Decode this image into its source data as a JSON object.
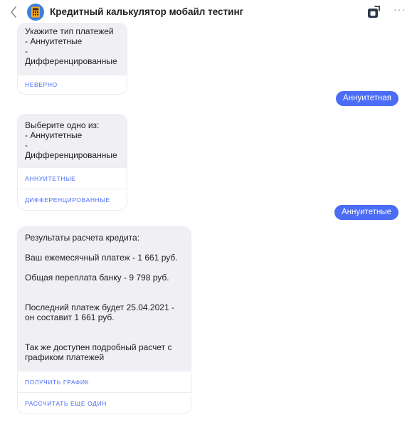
{
  "header": {
    "title": "Кредитный калькулятор мобайл тестинг",
    "back_icon": "chevron-left-icon",
    "avatar_icon": "calculator-avatar-icon",
    "action_icon": "open-icon",
    "more_label": "···"
  },
  "colors": {
    "accent": "#4a6cf7",
    "bubble_bg": "#f0f0f4"
  },
  "messages": {
    "m1": {
      "text": "Укажите тип платежей\n- Аннуитетные\n- Дифференцированные",
      "buttons": [
        "НЕВЕРНО"
      ]
    },
    "u1": {
      "text": "Аннуитетная"
    },
    "m2": {
      "text": "Выберите одно из:\n- Аннуитетные\n- Дифференцированные",
      "buttons": [
        "АННУИТЕТНЫЕ",
        "ДИФФЕРЕНЦИРОВАННЫЕ"
      ]
    },
    "u2": {
      "text": "Аннуитетные"
    },
    "m3": {
      "text": "Результаты расчета кредита:\n\nВаш ежемесячный платеж - 1 661 руб.\n\nОбщая переплата банку - 9 798 руб.\n\n\nПоследний платеж будет 25.04.2021 - он составит 1 661 руб.\n\n\nТак же доступен подробный расчет с графиком платежей",
      "buttons": [
        "ПОЛУЧИТЬ ГРАФИК",
        "РАССЧИТАТЬ ЕЩЕ ОДИН"
      ]
    }
  }
}
